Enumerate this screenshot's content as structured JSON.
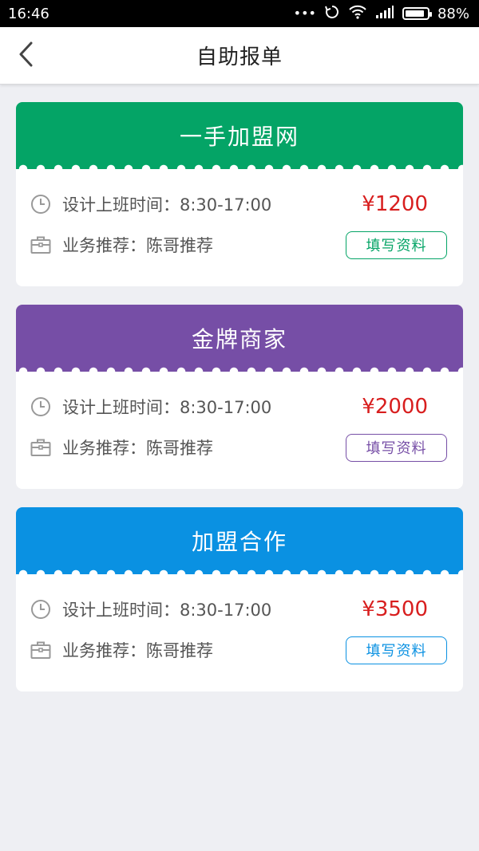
{
  "status_bar": {
    "time": "16:46",
    "dots": "•••",
    "battery_percent": "88%",
    "battery_level": 0.88
  },
  "nav": {
    "title": "自助报单",
    "back_icon": "chevron-left-icon"
  },
  "cards": [
    {
      "title": "一手加盟网",
      "color": "#04a466",
      "time_text": "设计上班时间：8:30-17:00",
      "price": "¥1200",
      "referral_text": "业务推荐：陈哥推荐",
      "button_label": "填写资料"
    },
    {
      "title": "金牌商家",
      "color": "#764ea6",
      "time_text": "设计上班时间：8:30-17:00",
      "price": "¥2000",
      "referral_text": "业务推荐：陈哥推荐",
      "button_label": "填写资料"
    },
    {
      "title": "加盟合作",
      "color": "#0a91e2",
      "time_text": "设计上班时间：8:30-17:00",
      "price": "¥3500",
      "referral_text": "业务推荐：陈哥推荐",
      "button_label": "填写资料"
    }
  ],
  "colors": {
    "price": "#d81e1e",
    "background": "#eeeff3"
  },
  "icons": {
    "time": "clock-icon",
    "referral": "briefcase-icon"
  }
}
